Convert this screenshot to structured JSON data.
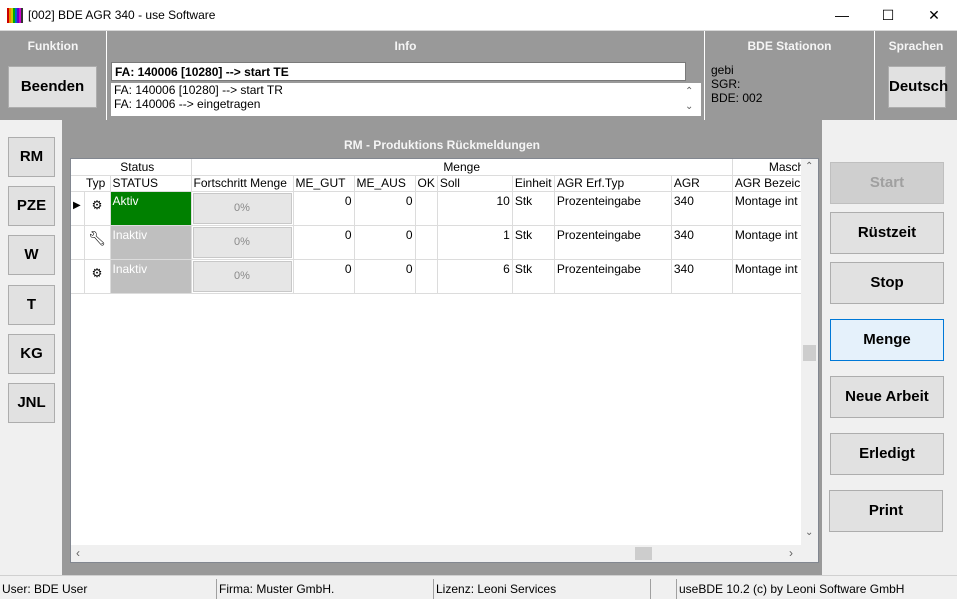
{
  "window": {
    "title": "[002] BDE AGR 340 - use Software",
    "minimize": "—",
    "maximize": "☐",
    "close": "✕"
  },
  "funktion": {
    "title": "Funktion",
    "quit_label": "Beenden"
  },
  "info": {
    "title": "Info",
    "current": "FA: 140006 [10280] --> start TE",
    "history": [
      "FA: 140006 [10280] --> start TR",
      "FA: 140006 --> eingetragen",
      "..."
    ]
  },
  "station": {
    "title": "BDE Stationon",
    "lines": [
      "gebi",
      "SGR:",
      "BDE: 002"
    ]
  },
  "sprachen": {
    "title": "Sprachen",
    "lang_label": "Deutsch"
  },
  "left_nav": [
    "RM",
    "PZE",
    "W",
    "T",
    "KG",
    "JNL"
  ],
  "main": {
    "title": "RM - Produktions Rückmeldungen",
    "group_headers": [
      "Status",
      "Menge",
      "Maschi"
    ],
    "columns": [
      "Typ",
      "STATUS",
      "Fortschritt Menge",
      "ME_GUT",
      "ME_AUS",
      "OK",
      "Soll",
      "Einheit",
      "AGR Erf.Typ",
      "AGR",
      "AGR Bezeich"
    ],
    "rows": [
      {
        "status": "Aktiv",
        "progress": "0%",
        "progress_value": 0,
        "me_gut": "0",
        "me_aus": "0",
        "ok": "",
        "soll": "10",
        "einheit": "Stk",
        "erf_typ": "Prozenteingabe",
        "agr": "340",
        "bezeichnung": "Montage int"
      },
      {
        "status": "Inaktiv",
        "progress": "0%",
        "progress_value": 0,
        "me_gut": "0",
        "me_aus": "0",
        "ok": "",
        "soll": "1",
        "einheit": "Stk",
        "erf_typ": "Prozenteingabe",
        "agr": "340",
        "bezeichnung": "Montage int"
      },
      {
        "status": "Inaktiv",
        "progress": "0%",
        "progress_value": 0,
        "me_gut": "0",
        "me_aus": "0",
        "ok": "",
        "soll": "6",
        "einheit": "Stk",
        "erf_typ": "Prozenteingabe",
        "agr": "340",
        "bezeichnung": "Montage int"
      }
    ],
    "row_icons": [
      "gear-icon",
      "wrench-icon",
      "gear-icon"
    ]
  },
  "actions": {
    "start": "Start",
    "ruestzeit": "Rüstzeit",
    "stop": "Stop",
    "menge": "Menge",
    "neue_arbeit": "Neue Arbeit",
    "erledigt": "Erledigt",
    "print": "Print"
  },
  "statusbar": {
    "user": "User: BDE User",
    "firma": "Firma: Muster GmbH.",
    "lizenz": "Lizenz: Leoni Services",
    "blank": "",
    "version": "useBDE 10.2 (c) by Leoni Software GmbH"
  },
  "colors": {
    "active": "#008000",
    "inactive": "#bfbfbf",
    "panel": "#999999",
    "selected_button": "#e5f1fb"
  }
}
